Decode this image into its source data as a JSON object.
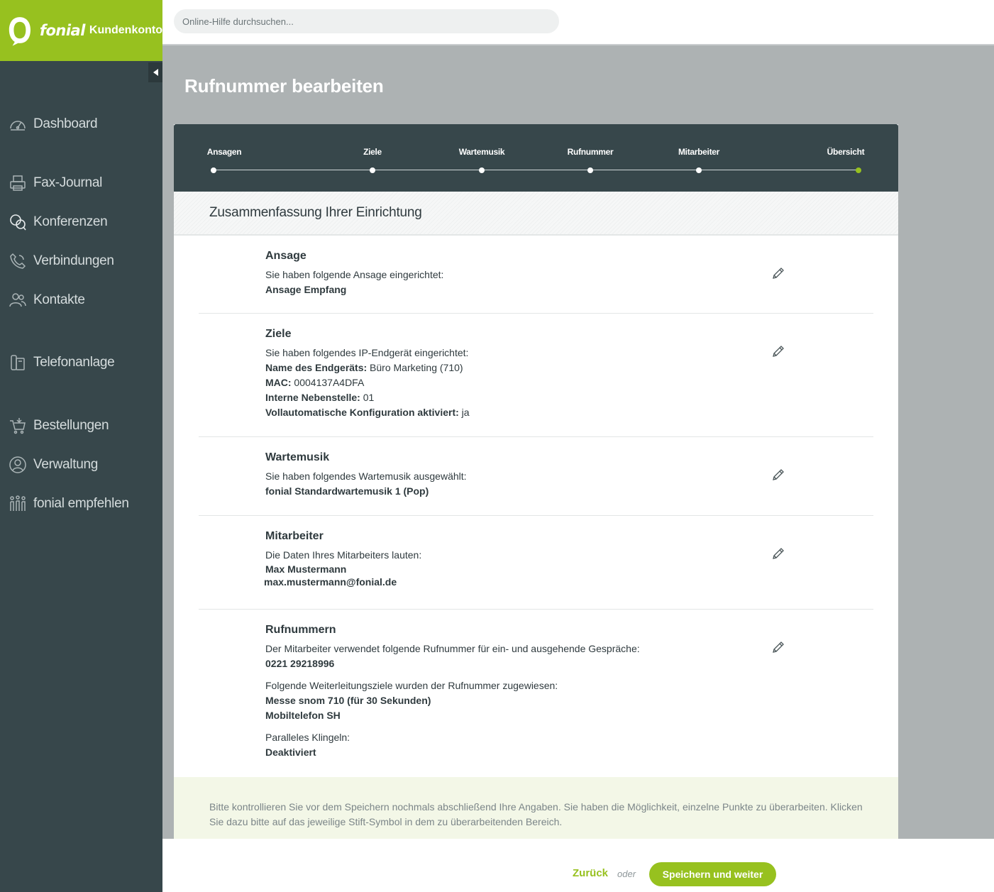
{
  "brand": {
    "name": "fonial",
    "sub": "Kundenkonto"
  },
  "search": {
    "placeholder": "Online-Hilfe durchsuchen..."
  },
  "sidebar": {
    "items": [
      {
        "label": "Dashboard",
        "icon": "speedometer-icon"
      },
      {
        "label": "Fax-Journal",
        "icon": "fax-icon"
      },
      {
        "label": "Konferenzen",
        "icon": "chat-bubbles-icon"
      },
      {
        "label": "Verbindungen",
        "icon": "phone-icon"
      },
      {
        "label": "Kontakte",
        "icon": "contacts-icon"
      },
      {
        "label": "Telefonanlage",
        "icon": "desk-phone-icon"
      },
      {
        "label": "Bestellungen",
        "icon": "cart-icon"
      },
      {
        "label": "Verwaltung",
        "icon": "user-icon"
      },
      {
        "label": "fonial empfehlen",
        "icon": "people-icon"
      }
    ]
  },
  "page": {
    "title": "Rufnummer bearbeiten"
  },
  "stepper": {
    "steps": [
      "Ansagen",
      "Ziele",
      "Wartemusik",
      "Rufnummer",
      "Mitarbeiter",
      "Übersicht"
    ],
    "active_step": "Übersicht"
  },
  "summary": {
    "heading": "Zusammenfassung Ihrer Einrichtung",
    "ansage": {
      "title": "Ansage",
      "text": "Sie haben folgende Ansage eingerichtet:",
      "value": "Ansage Empfang"
    },
    "ziele": {
      "title": "Ziele",
      "text": "Sie haben folgendes IP-Endgerät eingerichtet:",
      "device_label": "Name des Endgeräts:",
      "device_value": " Büro Marketing (710)",
      "mac_label": "MAC:",
      "mac_value": " 0004137A4DFA",
      "ext_label": "Interne Nebenstelle:",
      "ext_value": " 01",
      "auto_label": "Vollautomatische Konfiguration aktiviert:",
      "auto_value": " ja"
    },
    "wartemusik": {
      "title": "Wartemusik",
      "text": "Sie haben folgendes Wartemusik ausgewählt:",
      "value": "fonial Standardwartemusik 1 (Pop)"
    },
    "mitarbeiter": {
      "title": "Mitarbeiter",
      "text": "Die Daten Ihres Mitarbeiters lauten:",
      "name": "Max Mustermann",
      "email": "max.mustermann@fonial.de"
    },
    "rufnummern": {
      "title": "Rufnummern",
      "text": "Der Mitarbeiter verwendet folgende Rufnummer für ein- und ausgehende Gespräche:",
      "number": "0221 29218996",
      "forward_text": "Folgende Weiterleitungsziele wurden der Rufnummer zugewiesen:",
      "forward_1": "Messe snom 710 (für 30 Sekunden)",
      "forward_2": "Mobiltelefon SH",
      "parallel_text": "Paralleles Klingeln:",
      "parallel_value": "Deaktiviert"
    }
  },
  "hint": "Bitte kontrollieren Sie vor dem Speichern nochmals abschließend Ihre Angaben. Sie haben die Möglichkeit, einzelne Punkte zu überarbeiten. Klicken Sie dazu bitte auf das jeweilige Stift-Symbol in dem zu überarbeitenden Bereich.",
  "footer": {
    "back": "Zurück",
    "or": "oder",
    "save": "Speichern und weiter"
  },
  "colors": {
    "brand_green": "#97c11f",
    "sidebar": "#37474b",
    "main_bg": "#adb2b3"
  }
}
